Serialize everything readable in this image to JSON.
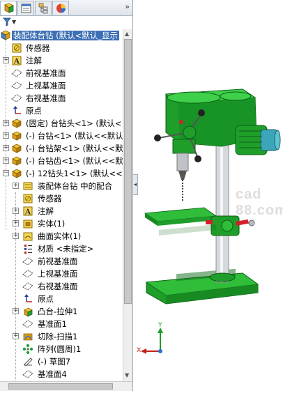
{
  "feature_manager": {
    "tabs": [
      {
        "name": "feature-tree-tab",
        "icon": "feature-tree-icon",
        "active": true
      },
      {
        "name": "property-tab",
        "icon": "property-manager-icon",
        "active": false
      },
      {
        "name": "configuration-tab",
        "icon": "configuration-manager-icon",
        "active": false
      },
      {
        "name": "appearance-tab",
        "icon": "appearance-icon",
        "active": false
      }
    ],
    "expand_arrow": "»",
    "filter_icon": "filter-icon",
    "splitter_glyph": "◂"
  },
  "tree": {
    "root": "装配体台钻  (默认<默认_显示",
    "items": [
      "传感器",
      "注解",
      "前视基准面",
      "上视基准面",
      "右视基准面",
      "原点",
      "(固定) 台钻头<1> (默认<",
      "(-) 台钻<1> (默认<<默认",
      "(-) 台钻架<1> (默认<<默",
      "(-) 台钻齿<1> (默认<<默",
      "(-) 12钻头1<1> (默认<<",
      "装配体台钻 中的配合",
      "传感器",
      "注解",
      "实体(1)",
      "曲面实体(1)",
      "材质 <未指定>",
      "前视基准面",
      "上视基准面",
      "右视基准面",
      "原点",
      "凸台-拉伸1",
      "基准面1",
      "切除-扫描1",
      "阵列(圆周)1",
      "(-) 草图7",
      "基准面4"
    ]
  },
  "viewport": {
    "watermark": "cad  88.com",
    "triad": {
      "x_label": "X",
      "y_label": "Y"
    }
  },
  "colors": {
    "machine_green": "#1f9e2a",
    "motor_teal": "#3aa6b8",
    "handle_red": "#d4202a",
    "selection_blue": "#3d6fb5"
  }
}
